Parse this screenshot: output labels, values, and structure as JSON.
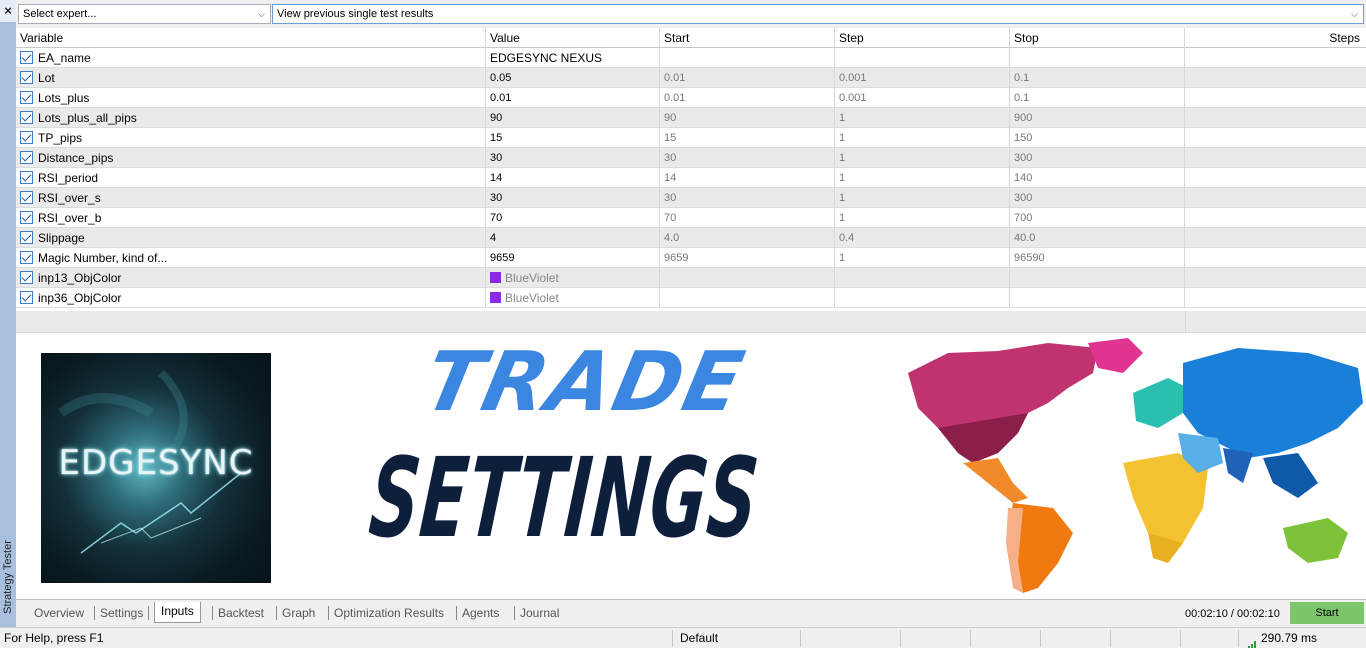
{
  "side": {
    "close_glyph": "×",
    "vertical_title": "Strategy Tester"
  },
  "topbar": {
    "expert_select": "Select expert...",
    "results_select": "View previous single test results"
  },
  "table": {
    "columns": [
      "Variable",
      "Value",
      "Start",
      "Step",
      "Stop",
      "Steps"
    ],
    "rows": [
      {
        "variable": "EA_name",
        "value": "EDGESYNC NEXUS",
        "start": "",
        "step": "",
        "stop": ""
      },
      {
        "variable": "Lot",
        "value": "0.05",
        "start": "0.01",
        "step": "0.001",
        "stop": "0.1"
      },
      {
        "variable": "Lots_plus",
        "value": "0.01",
        "start": "0.01",
        "step": "0.001",
        "stop": "0.1"
      },
      {
        "variable": "Lots_plus_all_pips",
        "value": "90",
        "start": "90",
        "step": "1",
        "stop": "900"
      },
      {
        "variable": "TP_pips",
        "value": "15",
        "start": "15",
        "step": "1",
        "stop": "150"
      },
      {
        "variable": "Distance_pips",
        "value": "30",
        "start": "30",
        "step": "1",
        "stop": "300"
      },
      {
        "variable": "RSI_period",
        "value": "14",
        "start": "14",
        "step": "1",
        "stop": "140"
      },
      {
        "variable": "RSI_over_s",
        "value": "30",
        "start": "30",
        "step": "1",
        "stop": "300"
      },
      {
        "variable": "RSI_over_b",
        "value": "70",
        "start": "70",
        "step": "1",
        "stop": "700"
      },
      {
        "variable": "Slippage",
        "value": "4",
        "start": "4.0",
        "step": "0.4",
        "stop": "40.0"
      },
      {
        "variable": "Magic Number, kind of...",
        "value": "9659",
        "start": "9659",
        "step": "1",
        "stop": "96590"
      },
      {
        "variable": "inp13_ObjColor",
        "value": "BlueViolet",
        "start": "",
        "step": "",
        "stop": ""
      },
      {
        "variable": "inp36_ObjColor",
        "value": "BlueViolet",
        "start": "",
        "step": "",
        "stop": ""
      }
    ],
    "swatch_color": "#8a2be2"
  },
  "banner": {
    "logo_text": "EDGESYNC",
    "headline_top": "TRADE",
    "headline_bottom": "SETTINGS",
    "headline_top_color": "#3a86e0",
    "headline_bottom_color": "#0e1f3c"
  },
  "tabs": {
    "items": [
      "Overview",
      "Settings",
      "Inputs",
      "Backtest",
      "Graph",
      "Optimization Results",
      "Agents",
      "Journal"
    ],
    "active": "Inputs",
    "timer": "00:02:10 / 00:02:10",
    "start_label": "Start",
    "start_color": "#7cc56a"
  },
  "status": {
    "help": "For Help, press F1",
    "profile": "Default",
    "ping": "290.79 ms"
  }
}
